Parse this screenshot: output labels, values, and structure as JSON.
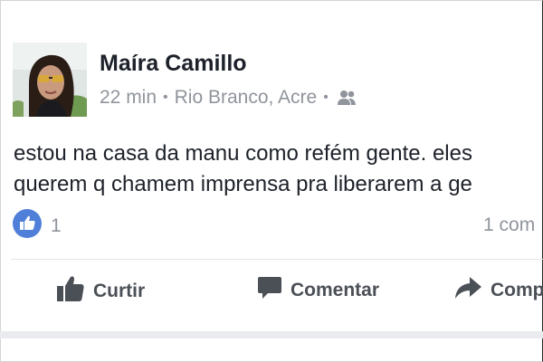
{
  "post": {
    "author": "Maíra Camillo",
    "time": "22 min",
    "separator": "•",
    "location": "Rio Branco, Acre",
    "privacy_icon": "friends-icon",
    "text_lines": [
      "estou na casa da manu como refém gente. eles",
      "querem q chamem  imprensa pra liberarem a ge"
    ],
    "likes": "1",
    "comments": "1 com"
  },
  "actions": {
    "like_label": "Curtir",
    "comment_label": "Comentar",
    "share_label": "Comp"
  },
  "colors": {
    "like_blue": "#4f7fd8",
    "text": "#1d2129",
    "secondary": "#90949c",
    "action_gray": "#4b4f56"
  }
}
